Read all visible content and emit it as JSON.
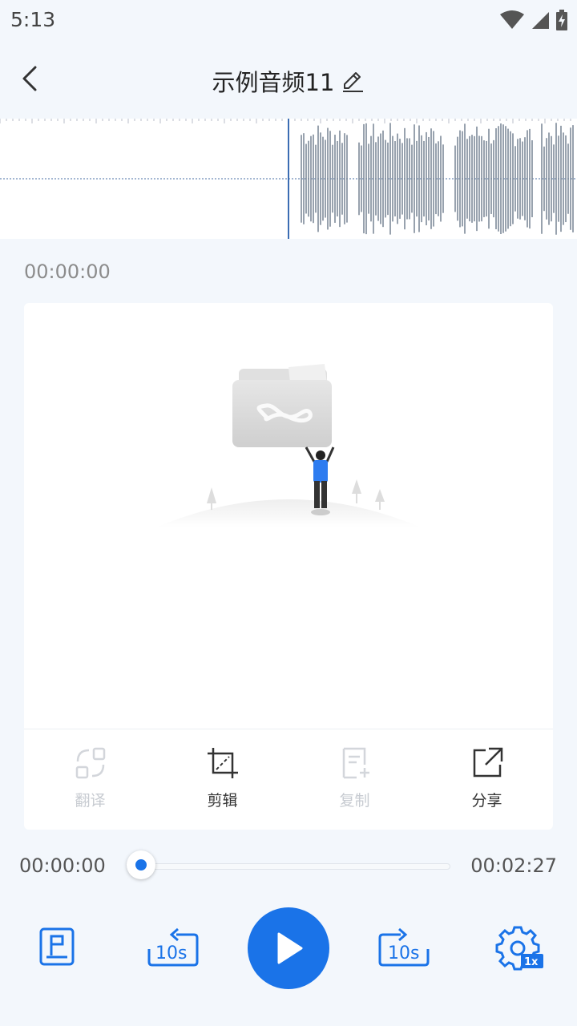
{
  "status": {
    "time": "5:13"
  },
  "header": {
    "title": "示例音频11"
  },
  "player": {
    "current_time": "00:00:00",
    "position": "00:00:00",
    "duration": "00:02:27",
    "progress": 0.0
  },
  "actions": [
    {
      "label": "翻译",
      "enabled": false
    },
    {
      "label": "剪辑",
      "enabled": true
    },
    {
      "label": "复制",
      "enabled": false
    },
    {
      "label": "分享",
      "enabled": true
    }
  ],
  "controls": {
    "speed_badge": "1x",
    "skip_back": "10s",
    "skip_forward": "10s"
  },
  "colors": {
    "accent": "#1a73e8",
    "background": "#f3f7fc",
    "wave": "#7f8a99"
  }
}
